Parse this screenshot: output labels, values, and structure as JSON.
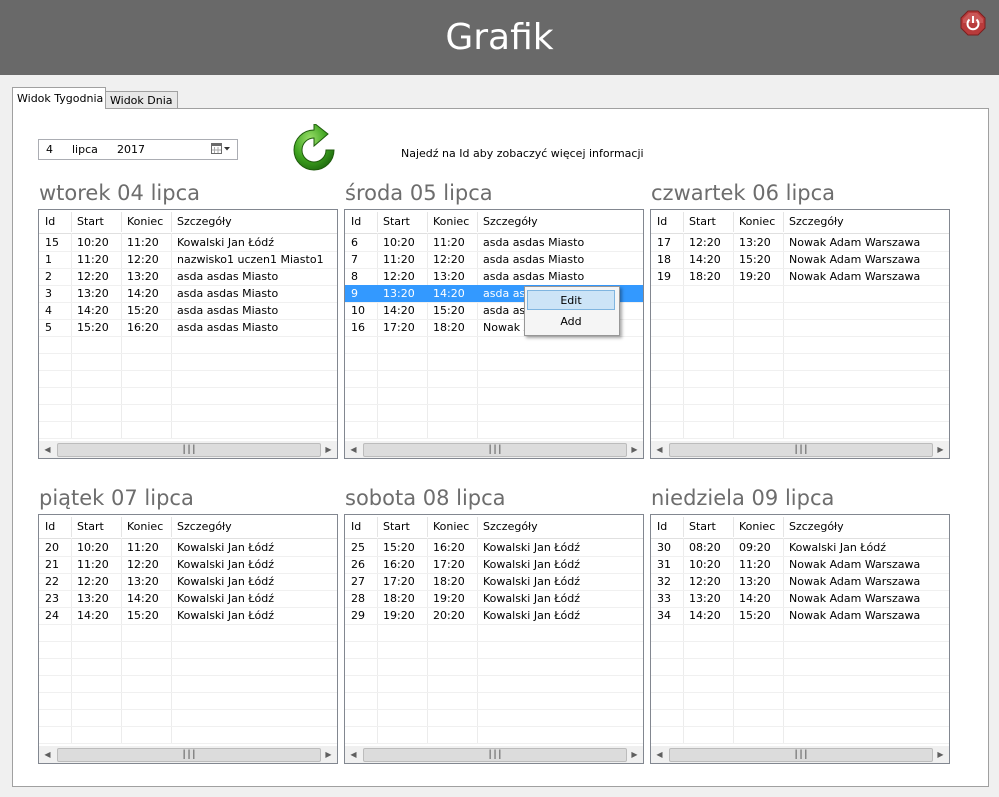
{
  "app": {
    "title": "Grafik"
  },
  "tabs": [
    {
      "label": "Widok Tygodnia",
      "active": true
    },
    {
      "label": "Widok Dnia",
      "active": false
    }
  ],
  "date": {
    "day": "4",
    "month": "lipca",
    "year": "2017"
  },
  "hint": "Najedź na Id aby zobaczyć więcej informacji",
  "columns": [
    "Id",
    "Start",
    "Koniec",
    "Szczegóły"
  ],
  "context_menu": {
    "items": [
      "Edit",
      "Add"
    ],
    "highlighted": "Edit"
  },
  "days": [
    {
      "title": "wtorek 04 lipca",
      "rows": [
        [
          "15",
          "10:20",
          "11:20",
          "Kowalski Jan Łódź"
        ],
        [
          "1",
          "11:20",
          "12:20",
          "nazwisko1 uczen1 Miasto1"
        ],
        [
          "2",
          "12:20",
          "13:20",
          "asda asdas Miasto"
        ],
        [
          "3",
          "13:20",
          "14:20",
          "asda asdas Miasto"
        ],
        [
          "4",
          "14:20",
          "15:20",
          "asda asdas Miasto"
        ],
        [
          "5",
          "15:20",
          "16:20",
          "asda asdas Miasto"
        ]
      ]
    },
    {
      "title": "środa 05 lipca",
      "selected_row": 3,
      "rows": [
        [
          "6",
          "10:20",
          "11:20",
          "asda asdas Miasto"
        ],
        [
          "7",
          "11:20",
          "12:20",
          "asda asdas Miasto"
        ],
        [
          "8",
          "12:20",
          "13:20",
          "asda asdas Miasto"
        ],
        [
          "9",
          "13:20",
          "14:20",
          "asda asdas Miasto"
        ],
        [
          "10",
          "14:20",
          "15:20",
          "asda asdas Miasto"
        ],
        [
          "16",
          "17:20",
          "18:20",
          "Nowak Adam Warszawa"
        ]
      ]
    },
    {
      "title": "czwartek 06 lipca",
      "rows": [
        [
          "17",
          "12:20",
          "13:20",
          "Nowak Adam Warszawa"
        ],
        [
          "18",
          "14:20",
          "15:20",
          "Nowak Adam Warszawa"
        ],
        [
          "19",
          "18:20",
          "19:20",
          "Nowak Adam Warszawa"
        ]
      ]
    },
    {
      "title": "piątek 07 lipca",
      "rows": [
        [
          "20",
          "10:20",
          "11:20",
          "Kowalski Jan Łódź"
        ],
        [
          "21",
          "11:20",
          "12:20",
          "Kowalski Jan Łódź"
        ],
        [
          "22",
          "12:20",
          "13:20",
          "Kowalski Jan Łódź"
        ],
        [
          "23",
          "13:20",
          "14:20",
          "Kowalski Jan Łódź"
        ],
        [
          "24",
          "14:20",
          "15:20",
          "Kowalski Jan Łódź"
        ]
      ]
    },
    {
      "title": "sobota 08 lipca",
      "rows": [
        [
          "25",
          "15:20",
          "16:20",
          "Kowalski Jan Łódź"
        ],
        [
          "26",
          "16:20",
          "17:20",
          "Kowalski Jan Łódź"
        ],
        [
          "27",
          "17:20",
          "18:20",
          "Kowalski Jan Łódź"
        ],
        [
          "28",
          "18:20",
          "19:20",
          "Kowalski Jan Łódź"
        ],
        [
          "29",
          "19:20",
          "20:20",
          "Kowalski Jan Łódź"
        ]
      ]
    },
    {
      "title": "niedziela 09 lipca",
      "rows": [
        [
          "30",
          "08:20",
          "09:20",
          "Kowalski Jan Łódź"
        ],
        [
          "31",
          "10:20",
          "11:20",
          "Nowak Adam Warszawa"
        ],
        [
          "32",
          "12:20",
          "13:20",
          "Nowak Adam Warszawa"
        ],
        [
          "33",
          "13:20",
          "14:20",
          "Nowak Adam Warszawa"
        ],
        [
          "34",
          "14:20",
          "15:20",
          "Nowak Adam Warszawa"
        ]
      ]
    }
  ],
  "icons": {
    "power": "power-icon",
    "refresh": "refresh-icon",
    "calendar": "calendar-icon"
  },
  "colors": {
    "header_bg": "#696969",
    "selection": "#3399ff",
    "day_title": "#6d6d6d"
  }
}
